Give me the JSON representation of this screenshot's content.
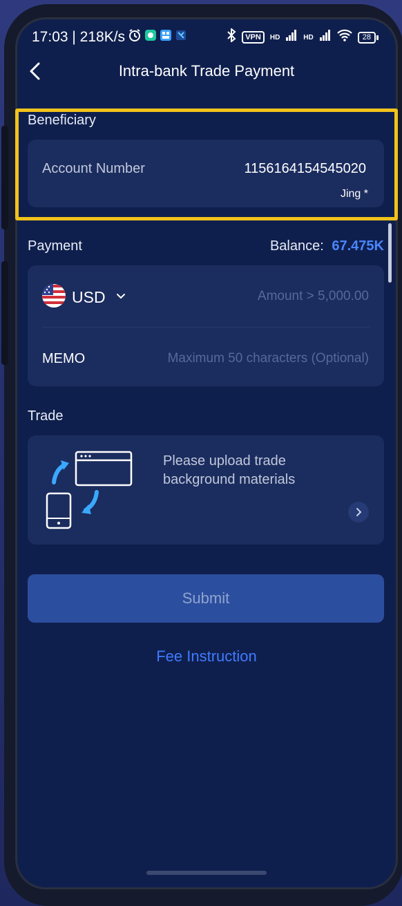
{
  "status_bar": {
    "time_speed": "17:03 | 218K/s",
    "vpn": "VPN",
    "hd1": "HD",
    "hd2": "HD",
    "battery": "28"
  },
  "header": {
    "title": "Intra-bank Trade Payment"
  },
  "beneficiary": {
    "section_label": "Beneficiary",
    "account_label": "Account Number",
    "account_number": "1156164154545020",
    "account_name": "Jing *"
  },
  "payment": {
    "section_label": "Payment",
    "balance_label": "Balance:",
    "balance_value": "67.475K",
    "currency": "USD",
    "amount_placeholder": "Amount > 5,000.00",
    "memo_label": "MEMO",
    "memo_placeholder": "Maximum 50 characters (Optional)"
  },
  "trade": {
    "section_label": "Trade",
    "upload_line1": "Please upload trade",
    "upload_line2": "background materials"
  },
  "actions": {
    "submit_label": "Submit",
    "fee_link": "Fee Instruction"
  },
  "colors": {
    "screen_bg": "#0f1f4d",
    "card_bg": "#1b2c5e",
    "accent_blue": "#3f7bff",
    "highlight_yellow": "#f1c21b",
    "submit_bg": "#2c4e9e"
  }
}
